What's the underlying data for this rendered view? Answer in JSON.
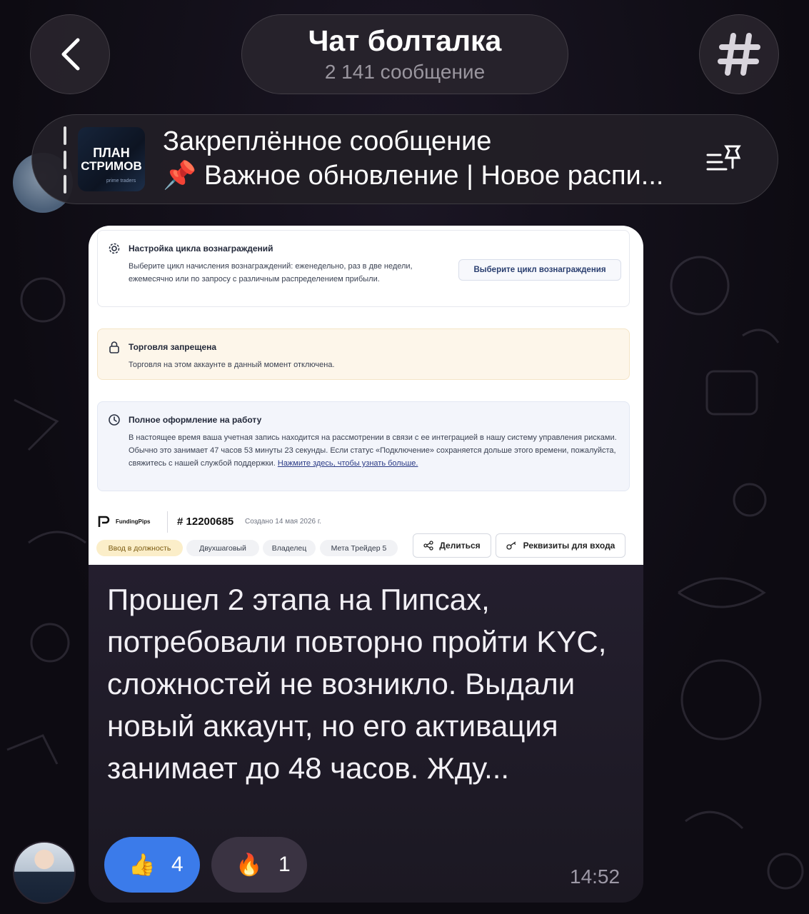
{
  "header": {
    "title": "Чат болталка",
    "subtitle": "2 141 сообщение"
  },
  "pinned": {
    "heading": "Закреплённое сообщение",
    "text": "📌 Важное обновление | Новое распи...",
    "thumb_line1": "ПЛАН",
    "thumb_line2": "СТРИМОВ",
    "thumb_line3": "prime traders"
  },
  "screenshot": {
    "reward_card": {
      "title": "Настройка цикла вознаграждений",
      "body": "Выберите цикл начисления вознаграждений: еженедельно, раз в две недели, ежемесячно или по запросу с различным распределением прибыли.",
      "button": "Выберите цикл вознаграждения"
    },
    "trade_card": {
      "title": "Торговля запрещена",
      "body": "Торговля на этом аккаунте в данный момент отключена."
    },
    "onboard_card": {
      "title": "Полное оформление на работу",
      "body": "В настоящее время ваша учетная запись находится на рассмотрении в связи с ее интеграцией в нашу систему управления рисками. Обычно это занимает 47 часов 53 минуты 23 секунды. Если статус «Подключение» сохраняется дольше этого времени, пожалуйста, свяжитесь с нашей службой поддержки.",
      "link": "Нажмите здесь, чтобы узнать больше."
    },
    "brand": "FundingPips",
    "account_number": "# 12200685",
    "created": "Создано 14 мая 2026 г.",
    "tags": [
      "Ввод в должность",
      "Двухшаговый",
      "Владелец",
      "Мета Трейдер 5"
    ],
    "share_button": "Делиться",
    "creds_button": "Реквизиты для входа"
  },
  "message": {
    "text": "Прошел 2 этапа на Пипсах, потребовали повторно пройти KYC, сложностей не возникло. Выдали новый аккаунт, но его активация занимает до 48 часов. Жду...",
    "time": "14:52",
    "reactions": [
      {
        "emoji": "👍",
        "count": "4"
      },
      {
        "emoji": "🔥",
        "count": "1"
      }
    ]
  },
  "colors": {
    "background": "#0d0b12",
    "bubble": "#2c2537",
    "reaction_active": "#3b7bea",
    "reaction_inactive": "#3a3342"
  }
}
